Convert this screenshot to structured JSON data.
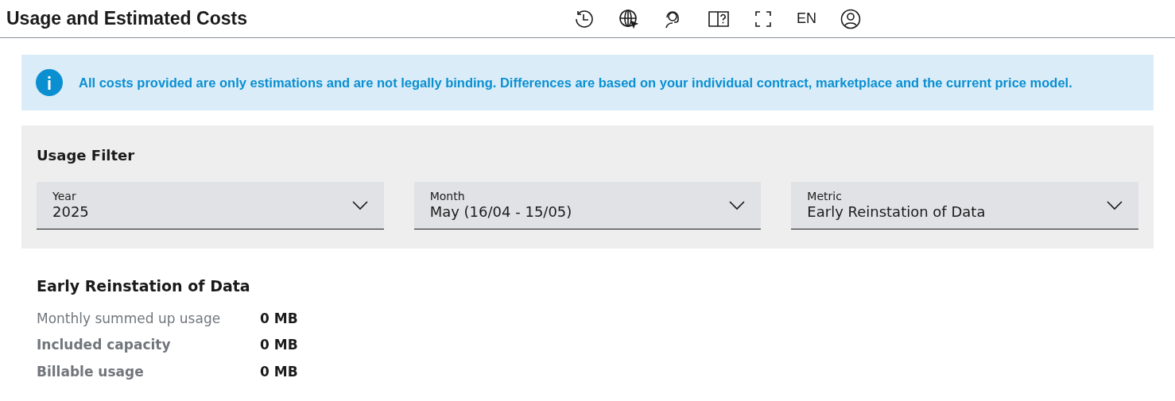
{
  "header": {
    "title": "Usage and Estimated Costs",
    "toolbar": [
      {
        "kind": "history"
      },
      {
        "kind": "globe"
      },
      {
        "kind": "support"
      },
      {
        "kind": "help"
      },
      {
        "kind": "fullscreen"
      },
      {
        "kind": "language",
        "label": "EN"
      },
      {
        "kind": "user"
      }
    ]
  },
  "notice": {
    "text": "All costs provided are only estimations and are not legally binding. Differences are based on your individual contract, marketplace and the current price model."
  },
  "filter": {
    "title": "Usage Filter",
    "dropdowns": [
      {
        "label": "Year",
        "value": "2025"
      },
      {
        "label": "Month",
        "value": "May (16/04 - 15/05)"
      },
      {
        "label": "Metric",
        "value": "Early Reinstation of Data"
      }
    ]
  },
  "result": {
    "title": "Early Reinstation of Data",
    "rows": [
      {
        "kind": "plain",
        "label": "Monthly summed up usage",
        "value": "0 MB"
      },
      {
        "kind": "bold",
        "label": "Included capacity",
        "value": "0 MB"
      },
      {
        "kind": "bold",
        "label": "Billable usage",
        "value": "0 MB"
      }
    ]
  }
}
